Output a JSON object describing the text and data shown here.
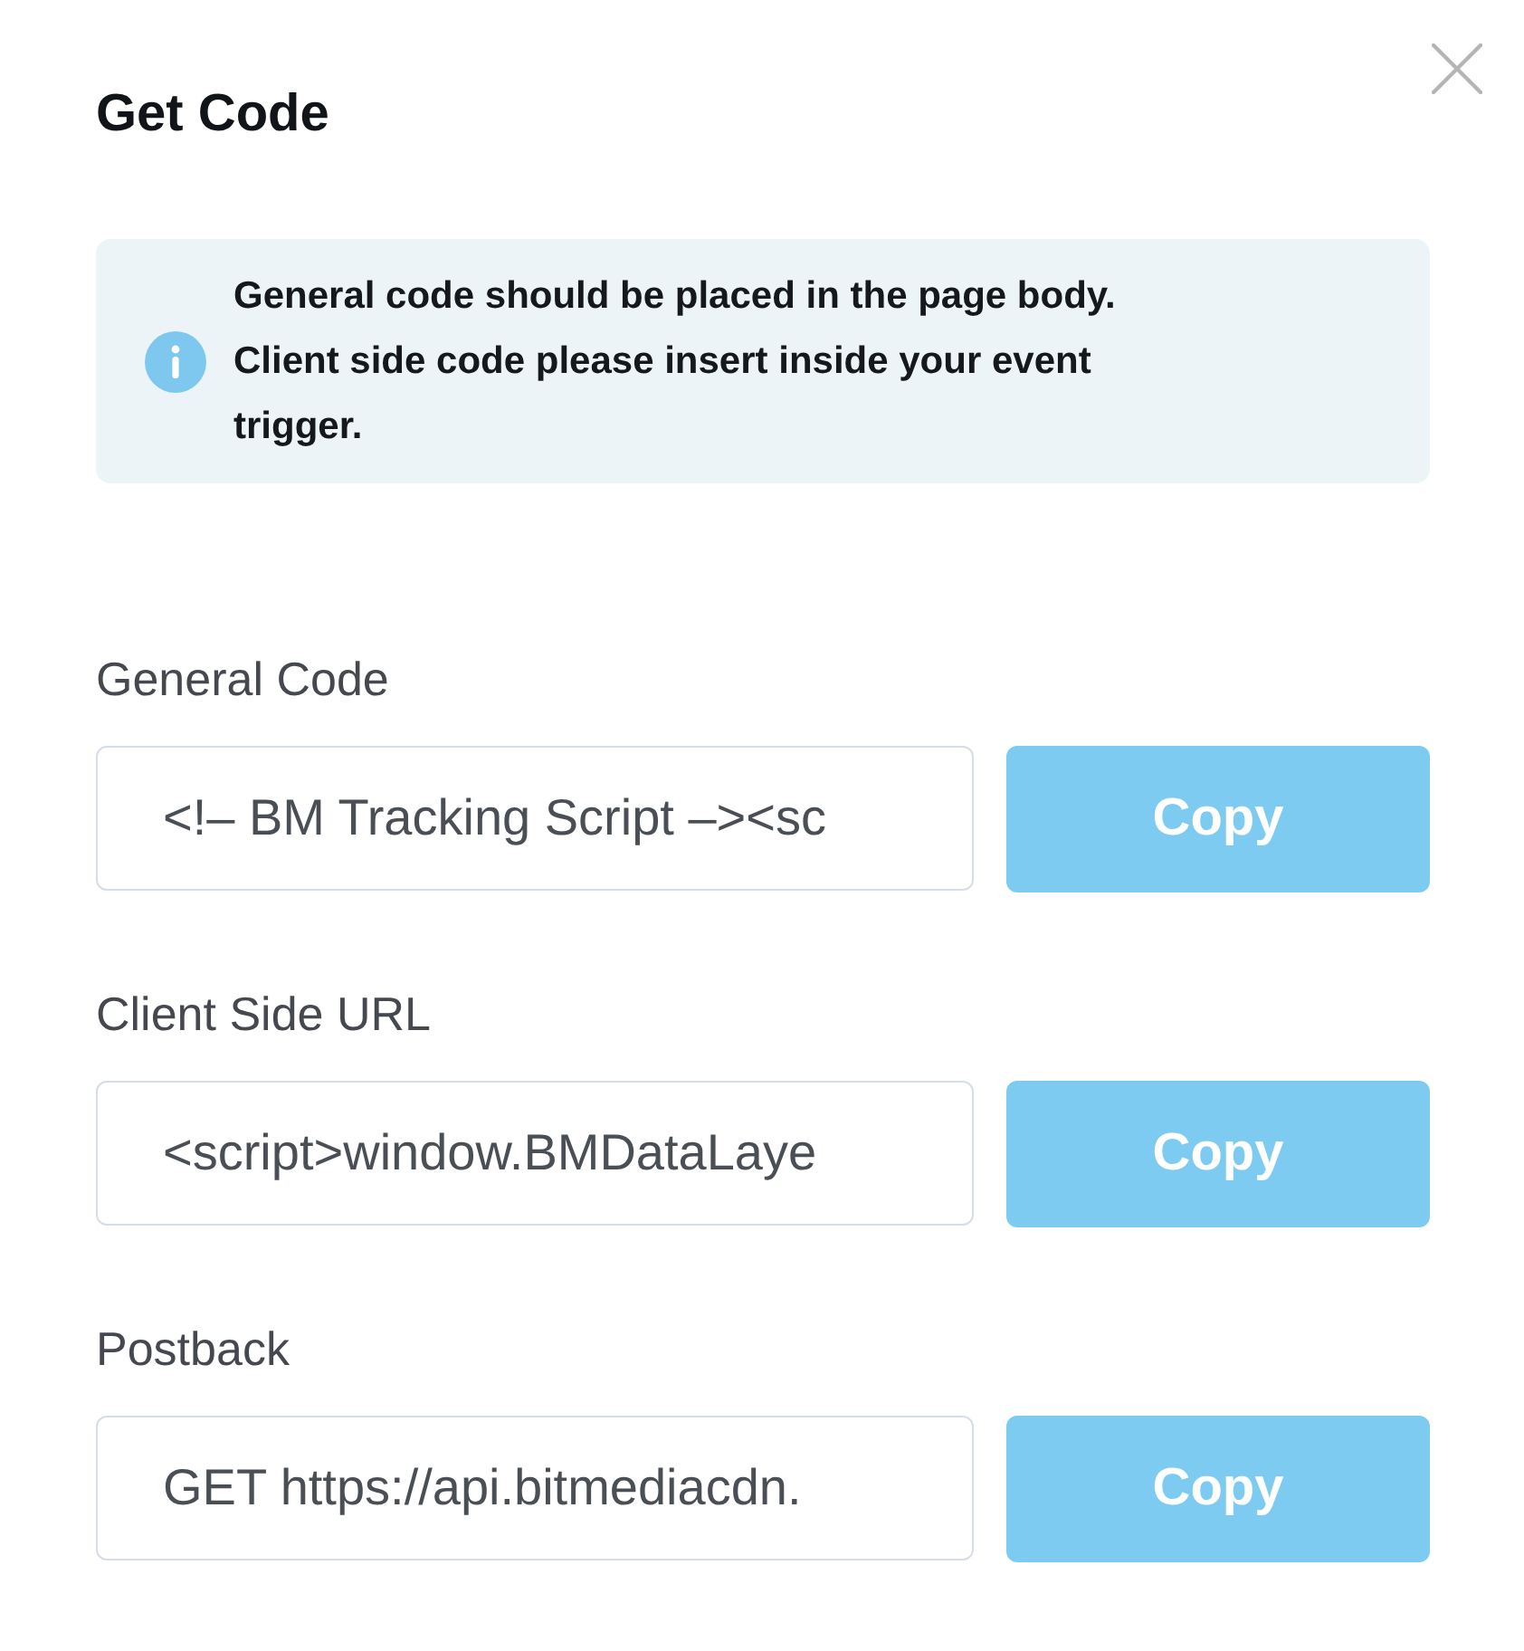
{
  "dialog": {
    "title": "Get Code"
  },
  "notice": {
    "paragraphs": [
      "General code should be placed in the page body.",
      "Client side code please insert inside your event trigger."
    ]
  },
  "fields": [
    {
      "label": "General Code",
      "value": "<!– BM Tracking Script –><sc",
      "button": "Copy"
    },
    {
      "label": "Client Side URL",
      "value": "<script>window.BMDataLaye",
      "button": "Copy"
    },
    {
      "label": "Postback",
      "value": "GET https://api.bitmediacdn.",
      "button": "Copy"
    }
  ]
}
